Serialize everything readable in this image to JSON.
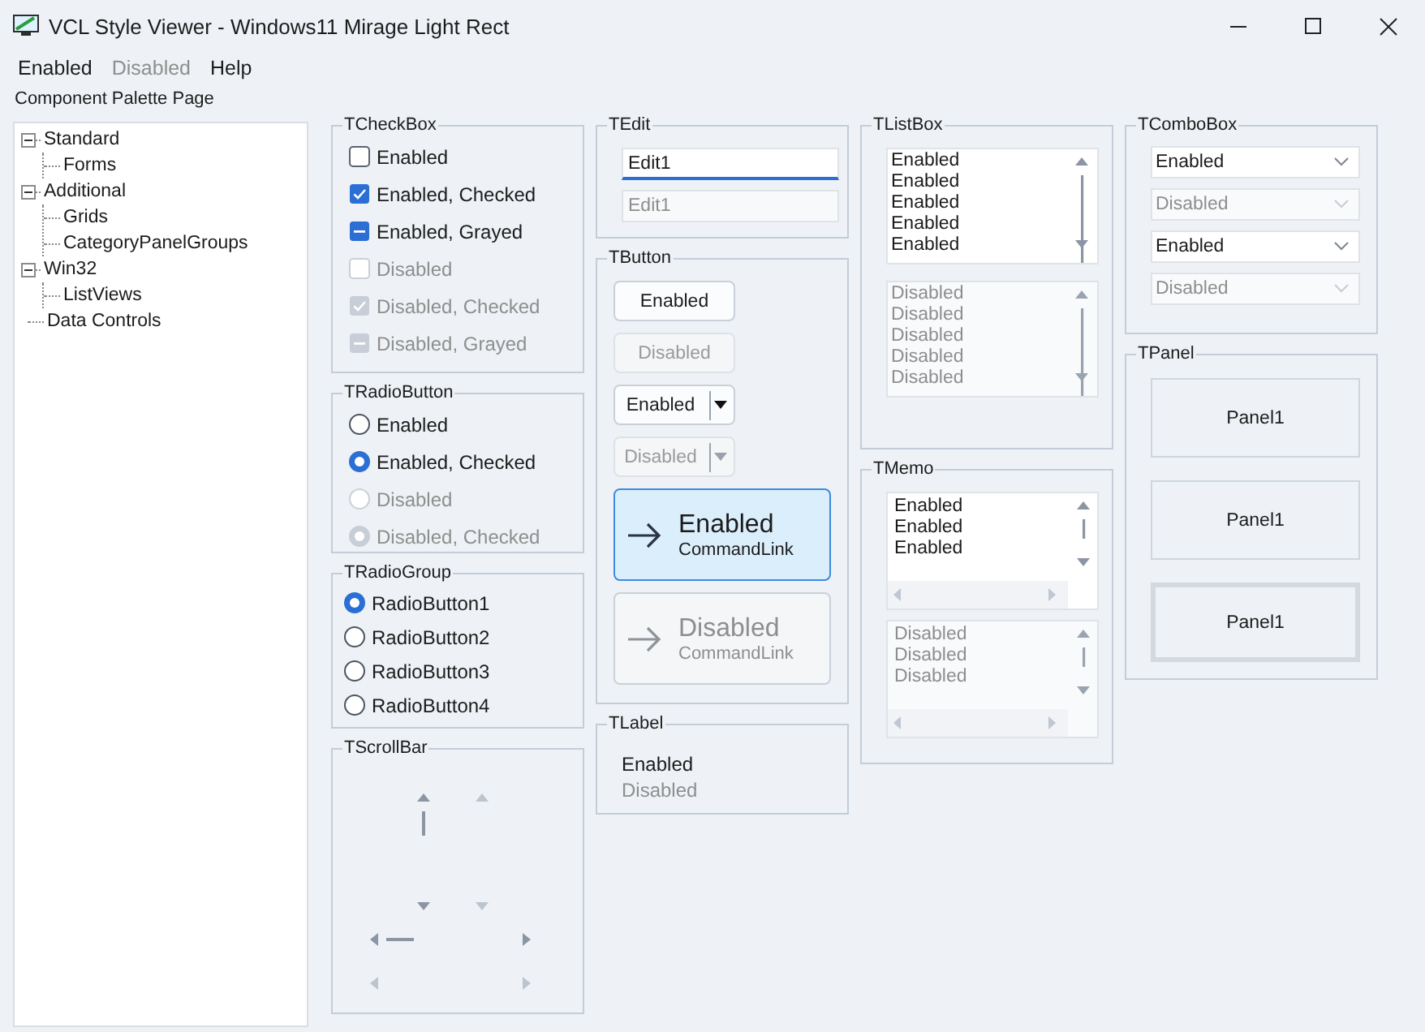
{
  "window": {
    "title": "VCL Style Viewer - Windows11 Mirage Light Rect"
  },
  "menu": [
    {
      "label": "Enabled",
      "disabled": false
    },
    {
      "label": "Disabled",
      "disabled": true
    },
    {
      "label": "Help",
      "disabled": false
    }
  ],
  "palette_label": "Component Palette Page",
  "tree": [
    {
      "label": "Standard",
      "expanded": true,
      "children": [
        {
          "label": "Forms"
        }
      ]
    },
    {
      "label": "Additional",
      "expanded": true,
      "children": [
        {
          "label": "Grids"
        },
        {
          "label": "CategoryPanelGroups"
        }
      ]
    },
    {
      "label": "Win32",
      "expanded": true,
      "children": [
        {
          "label": "ListViews"
        }
      ]
    },
    {
      "label": "Data Controls"
    }
  ],
  "checkboxes": {
    "title": "TCheckBox",
    "items": [
      {
        "label": "Enabled",
        "checked": false,
        "grayed": false,
        "disabled": false
      },
      {
        "label": "Enabled, Checked",
        "checked": true,
        "grayed": false,
        "disabled": false
      },
      {
        "label": "Enabled, Grayed",
        "checked": false,
        "grayed": true,
        "disabled": false
      },
      {
        "label": "Disabled",
        "checked": false,
        "grayed": false,
        "disabled": true
      },
      {
        "label": "Disabled, Checked",
        "checked": true,
        "grayed": false,
        "disabled": true
      },
      {
        "label": "Disabled, Grayed",
        "checked": false,
        "grayed": true,
        "disabled": true
      }
    ]
  },
  "radio_buttons": {
    "title": "TRadioButton",
    "items": [
      {
        "label": "Enabled",
        "selected": false,
        "disabled": false
      },
      {
        "label": "Enabled, Checked",
        "selected": true,
        "disabled": false
      },
      {
        "label": "Disabled",
        "selected": false,
        "disabled": true
      },
      {
        "label": "Disabled, Checked",
        "selected": true,
        "disabled": true
      }
    ]
  },
  "radio_group": {
    "title": "TRadioGroup",
    "items": [
      {
        "label": "RadioButton1",
        "selected": true
      },
      {
        "label": "RadioButton2",
        "selected": false
      },
      {
        "label": "RadioButton3",
        "selected": false
      },
      {
        "label": "RadioButton4",
        "selected": false
      }
    ]
  },
  "scrollbars": {
    "title": "TScrollBar"
  },
  "edit": {
    "title": "TEdit",
    "fields": [
      {
        "value": "Edit1",
        "disabled": false
      },
      {
        "value": "Edit1",
        "disabled": true
      }
    ]
  },
  "buttons": {
    "title": "TButton",
    "items": [
      {
        "kind": "push",
        "label": "Enabled",
        "disabled": false
      },
      {
        "kind": "push",
        "label": "Disabled",
        "disabled": true
      },
      {
        "kind": "split",
        "label": "Enabled",
        "disabled": false
      },
      {
        "kind": "split",
        "label": "Disabled",
        "disabled": true
      },
      {
        "kind": "command_link",
        "label": "Enabled",
        "note": "CommandLink",
        "disabled": false
      },
      {
        "kind": "command_link",
        "label": "Disabled",
        "note": "CommandLink",
        "disabled": true
      }
    ]
  },
  "label": {
    "title": "TLabel",
    "items": [
      {
        "text": "Enabled",
        "disabled": false
      },
      {
        "text": "Disabled",
        "disabled": true
      }
    ]
  },
  "listbox": {
    "title": "TListBox",
    "lists": [
      {
        "disabled": false,
        "items": [
          "Enabled",
          "Enabled",
          "Enabled",
          "Enabled",
          "Enabled"
        ]
      },
      {
        "disabled": true,
        "items": [
          "Disabled",
          "Disabled",
          "Disabled",
          "Disabled",
          "Disabled"
        ]
      }
    ]
  },
  "memo": {
    "title": "TMemo",
    "memos": [
      {
        "disabled": false,
        "lines": [
          "Enabled",
          "Enabled",
          "Enabled"
        ]
      },
      {
        "disabled": true,
        "lines": [
          "Disabled",
          "Disabled",
          "Disabled"
        ]
      }
    ]
  },
  "combobox": {
    "title": "TComboBox",
    "items": [
      {
        "value": "Enabled",
        "disabled": false
      },
      {
        "value": "Disabled",
        "disabled": true
      },
      {
        "value": "Enabled",
        "disabled": false
      },
      {
        "value": "Disabled",
        "disabled": true
      }
    ]
  },
  "panel": {
    "title": "TPanel",
    "panels": [
      {
        "label": "Panel1",
        "kind": "flat"
      },
      {
        "label": "Panel1",
        "kind": "flat"
      },
      {
        "label": "Panel1",
        "kind": "framed"
      }
    ]
  }
}
